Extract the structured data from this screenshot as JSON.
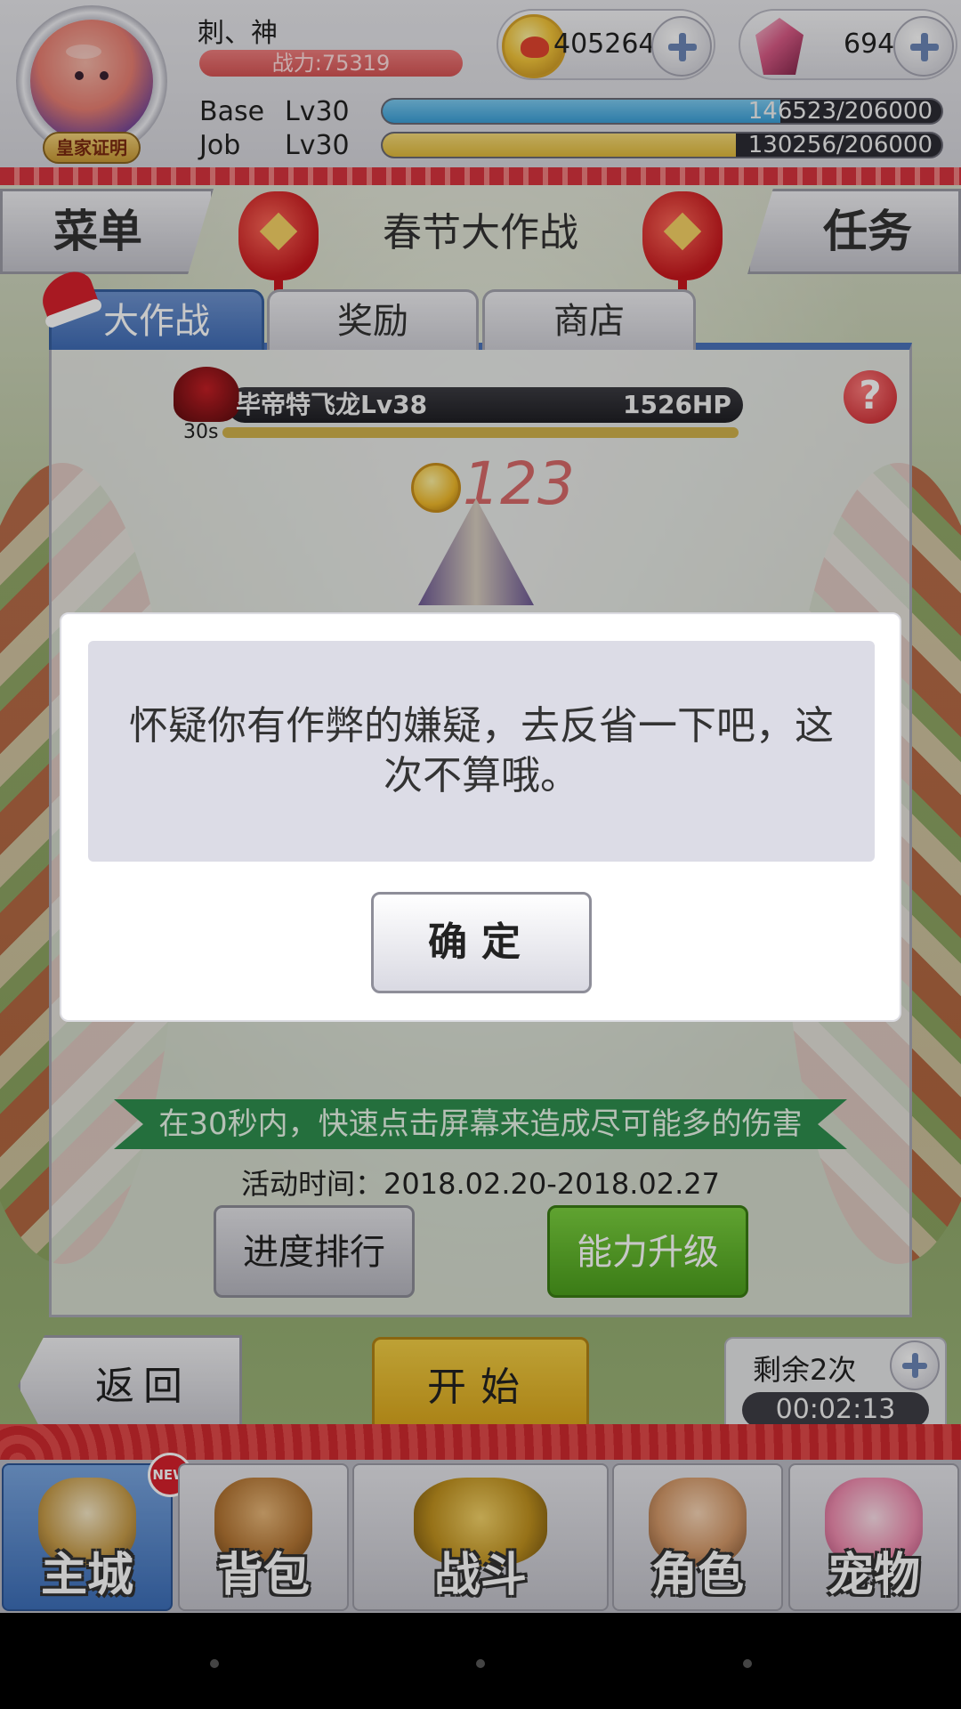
{
  "player": {
    "name": "刺、神",
    "power": "战力:75319",
    "badge": "皇家证明",
    "base_label": "Base",
    "base_level": "Lv30",
    "base_xp": "146523/206000",
    "base_xp_fraction": 0.711,
    "job_label": "Job",
    "job_level": "Lv30",
    "job_xp": "130256/206000",
    "job_xp_fraction": 0.632
  },
  "currency": {
    "coins": "405264",
    "gems": "694"
  },
  "nav_top": {
    "menu": "菜单",
    "title": "春节大作战",
    "task": "任务"
  },
  "tabs": [
    {
      "label": "大作战"
    },
    {
      "label": "奖励"
    },
    {
      "label": "商店"
    }
  ],
  "battle": {
    "boss_name": "毕帝特飞龙Lv38",
    "boss_hp": "1526HP",
    "timer": "30s",
    "damage": "123",
    "help": "?"
  },
  "event": {
    "banner": "在30秒内，快速点击屏幕来造成尽可能多的伤害",
    "time": "活动时间：2018.02.20-2018.02.27",
    "rank_button": "进度排行",
    "upgrade_button": "能力升级"
  },
  "controls": {
    "back": "返回",
    "start": "开始",
    "remaining": "剩余2次",
    "countdown": "00:02:13"
  },
  "bottom_nav": [
    {
      "label": "主城",
      "badge": "NEW"
    },
    {
      "label": "背包"
    },
    {
      "label": "战斗"
    },
    {
      "label": "角色"
    },
    {
      "label": "宠物"
    }
  ],
  "dialog": {
    "message": "怀疑你有作弊的嫌疑，去反省一下吧，这次不算哦。",
    "confirm": "确定"
  },
  "colors": {
    "base_xp": "#3ba0d8",
    "job_xp": "#e0b93a",
    "accent_blue": "#4b74bb",
    "start_yellow": "#e3b52c",
    "upgrade_green": "#5fb52a"
  }
}
